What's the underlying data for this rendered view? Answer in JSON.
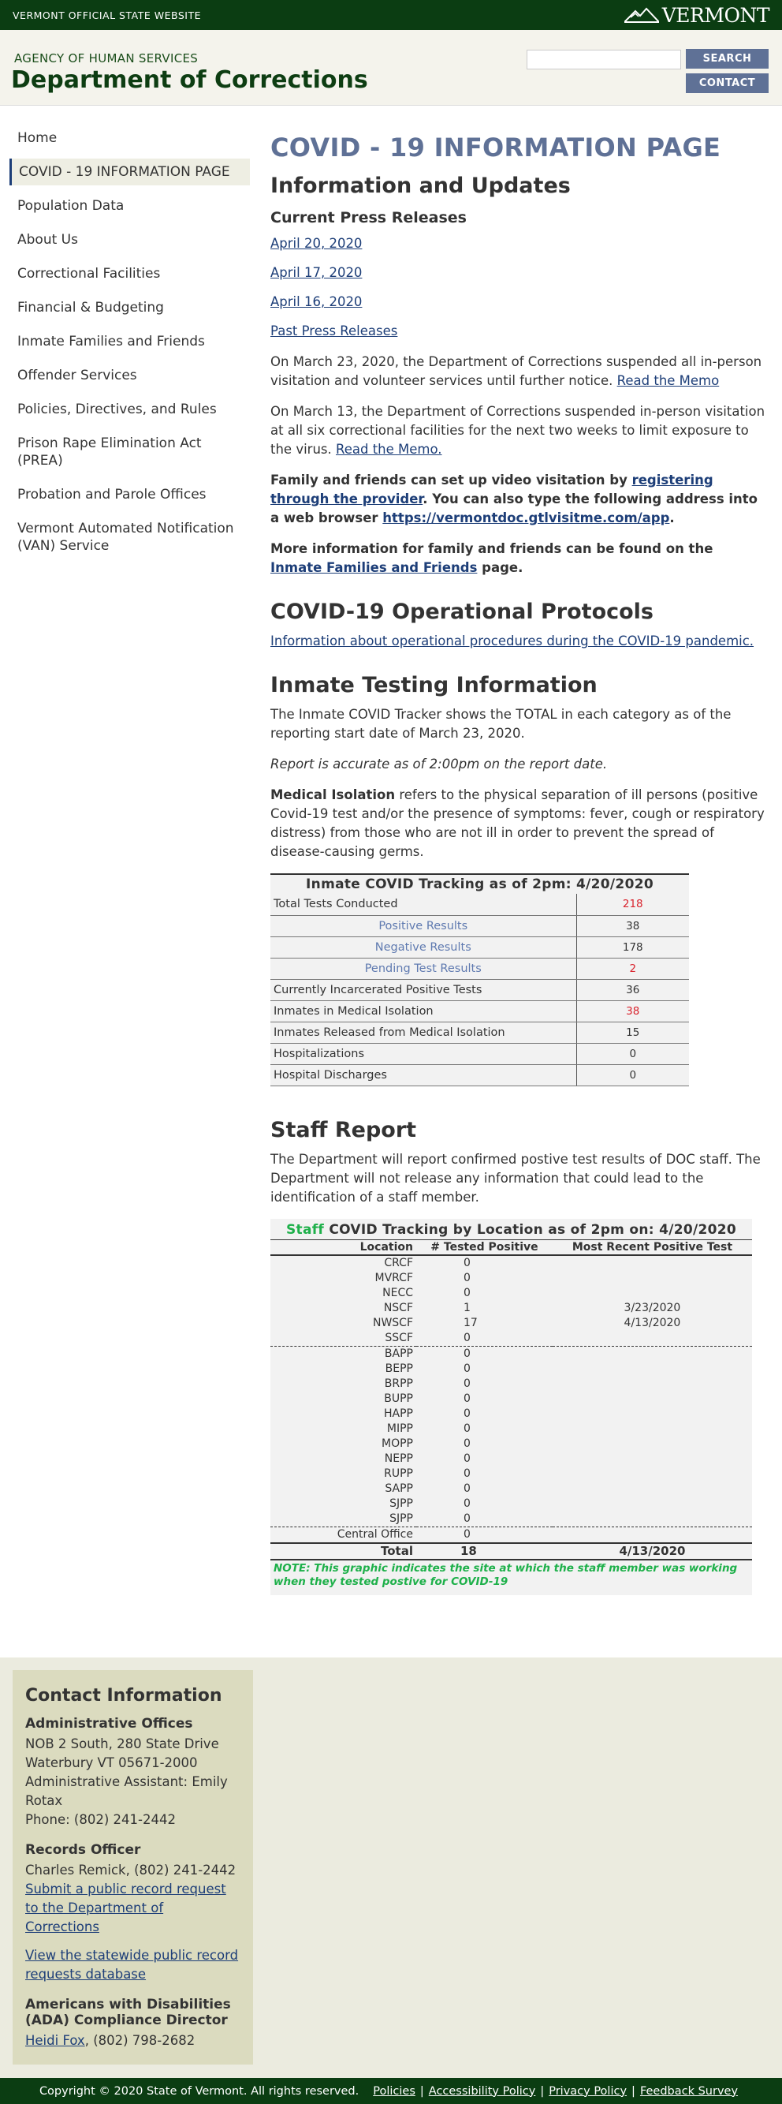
{
  "topbar": {
    "official": "VERMONT OFFICIAL STATE WEBSITE",
    "logo": "VERMONT"
  },
  "header": {
    "agency": "AGENCY OF HUMAN SERVICES",
    "dept": "Department of Corrections",
    "search_value": "",
    "search_label": "SEARCH",
    "contact_label": "CONTACT"
  },
  "sidebar": {
    "items": [
      {
        "label": "Home"
      },
      {
        "label": "COVID - 19 INFORMATION PAGE"
      },
      {
        "label": "Population Data"
      },
      {
        "label": "About Us"
      },
      {
        "label": "Correctional Facilities"
      },
      {
        "label": "Financial & Budgeting"
      },
      {
        "label": "Inmate Families and Friends"
      },
      {
        "label": "Offender Services"
      },
      {
        "label": "Policies, Directives, and Rules"
      },
      {
        "label": "Prison Rape Elimination Act (PREA)"
      },
      {
        "label": "Probation and Parole Offices"
      },
      {
        "label": "Vermont Automated Notification (VAN) Service"
      }
    ]
  },
  "main": {
    "title": "COVID - 19 INFORMATION PAGE",
    "updates_heading": "Information and Updates",
    "press_heading": "Current Press Releases",
    "press_links": [
      "April 20, 2020",
      "April 17, 2020",
      "April 16, 2020",
      "Past Press Releases"
    ],
    "para1_text": "On March 23, 2020, the Department of Corrections suspended all in-person visitation and volunteer services until further notice. ",
    "para1_link": "Read the Memo",
    "para2_text": "On March 13, the Department of Corrections suspended in-person visitation at all six correctional facilities for the next two weeks to limit exposure to the virus.  ",
    "para2_link": "Read the Memo.",
    "para3_a": "Family and friends can set up video visitation by ",
    "para3_link1": "registering through the provider",
    "para3_b": ". You can also type the following address into a web browser ",
    "para3_link2": "https://vermontdoc.gtlvisitme.com/app",
    "para3_c": ".",
    "para4_a": "More information for family and friends can be found on the",
    "para4_link": " Inmate Families and Friends",
    "para4_b": " page.",
    "protocols_heading": "COVID-19 Operational Protocols",
    "protocols_link": "Information about operational procedures during the COVID-19 pandemic.",
    "testing_heading": "Inmate Testing Information",
    "testing_para": "The Inmate COVID Tracker shows the TOTAL in each category as of the reporting start date of March 23, 2020.",
    "accuracy_note": "Report is accurate as of 2:00pm on the report date.",
    "isolation_term": "Medical Isolation",
    "isolation_text": " refers to the physical separation of ill persons (positive Covid-19 test and/or the presence of symptoms: fever, cough or respiratory distress) from those who are not ill in order to prevent the spread of disease-causing germs.",
    "staff_heading": "Staff Report",
    "staff_para": "The Department will report confirmed postive test results of DOC staff. The Department will not release any information that could lead to the identification of a staff member."
  },
  "inmate_table": {
    "caption": "Inmate COVID Tracking as of 2pm: 4/20/2020",
    "rows": [
      {
        "label": "Total Tests Conducted",
        "value": "218"
      },
      {
        "label": "Positive Results",
        "value": "38"
      },
      {
        "label": "Negative Results",
        "value": "178"
      },
      {
        "label": "Pending Test Results",
        "value": "2"
      },
      {
        "label": "Currently Incarcerated Positive Tests",
        "value": "36"
      },
      {
        "label": "Inmates in Medical Isolation",
        "value": "38"
      },
      {
        "label": "Inmates Released from Medical Isolation",
        "value": "15"
      },
      {
        "label": "Hospitalizations",
        "value": "0"
      },
      {
        "label": "Hospital Discharges",
        "value": "0"
      }
    ]
  },
  "staff_table": {
    "title_green": "Staff",
    "title_rest": " COVID Tracking by Location as of 2pm on: 4/20/2020",
    "headers": {
      "location": "Location",
      "tested": "# Tested Positive",
      "recent": "Most Recent Positive Test"
    },
    "rows": [
      {
        "loc": "CRCF",
        "num": "0",
        "recent": ""
      },
      {
        "loc": "MVRCF",
        "num": "0",
        "recent": ""
      },
      {
        "loc": "NECC",
        "num": "0",
        "recent": ""
      },
      {
        "loc": "NSCF",
        "num": "1",
        "recent": "3/23/2020"
      },
      {
        "loc": "NWSCF",
        "num": "17",
        "recent": "4/13/2020"
      },
      {
        "loc": "SSCF",
        "num": "0",
        "recent": ""
      },
      {
        "loc": "BAPP",
        "num": "0",
        "recent": ""
      },
      {
        "loc": "BEPP",
        "num": "0",
        "recent": ""
      },
      {
        "loc": "BRPP",
        "num": "0",
        "recent": ""
      },
      {
        "loc": "BUPP",
        "num": "0",
        "recent": ""
      },
      {
        "loc": "HAPP",
        "num": "0",
        "recent": ""
      },
      {
        "loc": "MIPP",
        "num": "0",
        "recent": ""
      },
      {
        "loc": "MOPP",
        "num": "0",
        "recent": ""
      },
      {
        "loc": "NEPP",
        "num": "0",
        "recent": ""
      },
      {
        "loc": "RUPP",
        "num": "0",
        "recent": ""
      },
      {
        "loc": "SAPP",
        "num": "0",
        "recent": ""
      },
      {
        "loc": "SJPP",
        "num": "0",
        "recent": ""
      },
      {
        "loc": "SJPP",
        "num": "0",
        "recent": ""
      },
      {
        "loc": "Central Office",
        "num": "0",
        "recent": ""
      }
    ],
    "total": {
      "loc": "Total",
      "num": "18",
      "recent": "4/13/2020"
    },
    "note": "NOTE: This graphic indicates the site at which the staff member was working when they tested postive for COVID-19"
  },
  "contact": {
    "heading": "Contact Information",
    "admin_heading": "Administrative Offices",
    "admin_lines": [
      "NOB 2 South, 280 State Drive",
      "Waterbury VT 05671-2000",
      "Administrative Assistant: Emily Rotax",
      "Phone: (802) 241-2442"
    ],
    "records_heading": "Records Officer",
    "records_line": "Charles Remick, (802) 241-2442",
    "records_link1": "Submit a public record request to the Department of Corrections",
    "records_link2": "View the statewide public record requests database",
    "ada_heading": "Americans with Disabilities (ADA) Compliance Director",
    "ada_link": "Heidi Fox",
    "ada_phone": ", (802) 798-2682"
  },
  "footer": {
    "copyright": "Copyright © 2020 State of Vermont. All rights reserved.",
    "links": [
      "Policies",
      "Accessibility Policy",
      "Privacy Policy",
      "Feedback Survey"
    ]
  },
  "colors": {
    "dark_green": "#0b3d12",
    "accent_blue": "#5f7196",
    "link": "#1d3e78",
    "alert_red": "#d9232d",
    "staff_green": "#1eb04a"
  }
}
